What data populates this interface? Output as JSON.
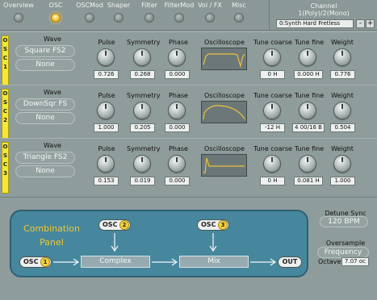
{
  "tabs": [
    {
      "label": "Overview",
      "active": false
    },
    {
      "label": "OSC",
      "active": true
    },
    {
      "label": "OSCMod",
      "active": false
    },
    {
      "label": "Shaper",
      "active": false
    },
    {
      "label": "Filter",
      "active": false
    },
    {
      "label": "FilterMod",
      "active": false
    },
    {
      "label": "Vol / FX",
      "active": false
    },
    {
      "label": "Misc",
      "active": false
    }
  ],
  "channel": {
    "title_line1": "Channel",
    "title_line2": "1(Poly)/2(Mono)",
    "preset": "0:Synth Hard Fretless",
    "minus": "-",
    "plus": "+"
  },
  "param_labels": {
    "wave": "Wave",
    "pulse": "Pulse",
    "symmetry": "Symmetry",
    "phase": "Phase",
    "oscilloscope": "Oscilloscope",
    "tune_coarse": "Tune coarse",
    "tune_fine": "Tune fine",
    "weight": "Weight"
  },
  "oscillators": [
    {
      "tag": [
        "O",
        "S",
        "C",
        "1"
      ],
      "wave": "Square FS2",
      "wave2": "None",
      "pulse": "0.726",
      "symmetry": "0.268",
      "phase": "0.000",
      "tune_coarse": "0 H",
      "tune_fine": "0.000 H",
      "weight": "0.776"
    },
    {
      "tag": [
        "O",
        "S",
        "C",
        "2"
      ],
      "wave": "DownSqr FS",
      "wave2": "None",
      "pulse": "1.000",
      "symmetry": "0.205",
      "phase": "0.000",
      "tune_coarse": "-12 H",
      "tune_fine": "4 00/16 B",
      "weight": "0.504"
    },
    {
      "tag": [
        "O",
        "S",
        "C",
        "3"
      ],
      "wave": "Triangle FS2",
      "wave2": "None",
      "pulse": "0.153",
      "symmetry": "0.019",
      "phase": "0.000",
      "tune_coarse": "0 H",
      "tune_fine": "0.081 H",
      "weight": "1.000"
    }
  ],
  "combination": {
    "title_line1": "Combination",
    "title_line2": "Panel",
    "osc_label": "OSC",
    "n1": "1",
    "n2": "2",
    "n3": "3",
    "complex": "Complex",
    "mix": "Mix",
    "out": "OUT"
  },
  "detune": {
    "label": "Detune Sync",
    "value": "120 BPM"
  },
  "oversample": {
    "label": "Oversample",
    "value": "Frequency",
    "octave_label": "Octave",
    "octave_value": "7.07 oc"
  },
  "colors": {
    "accent": "#f3c23a",
    "panel": "#8e9c9b",
    "combo": "#46879e",
    "scope_trace": "#f0c040"
  }
}
